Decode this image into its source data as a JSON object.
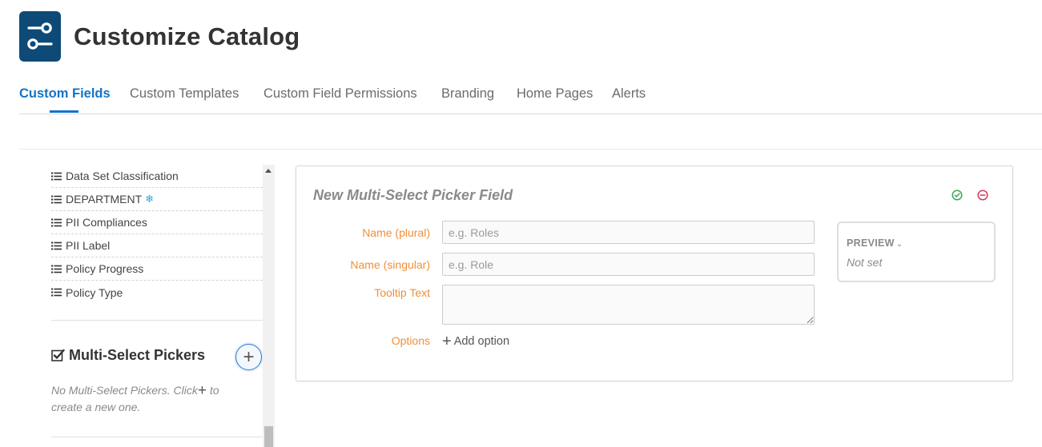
{
  "header": {
    "title": "Customize Catalog",
    "logo_icon": "settings-sliders-icon",
    "logo_color": "#0e4a77"
  },
  "tabs": [
    {
      "label": "Custom Fields",
      "active": true
    },
    {
      "label": "Custom Templates",
      "active": false
    },
    {
      "label": "Custom Field Permissions",
      "active": false
    },
    {
      "label": "Branding",
      "active": false
    },
    {
      "label": "Home Pages",
      "active": false
    },
    {
      "label": "Alerts",
      "active": false
    }
  ],
  "sidebar": {
    "items": [
      {
        "label": "Data Set Classification",
        "icon": "list-icon"
      },
      {
        "label": "DEPARTMENT",
        "icon": "list-icon",
        "badge_icon": "snowflake-icon"
      },
      {
        "label": "PII Compliances",
        "icon": "list-icon"
      },
      {
        "label": "PII Label",
        "icon": "list-icon"
      },
      {
        "label": "Policy Progress",
        "icon": "list-icon"
      },
      {
        "label": "Policy Type",
        "icon": "list-icon"
      }
    ],
    "section": {
      "title": "Multi-Select Pickers",
      "icon": "checkbox-icon",
      "add_icon": "plus-icon",
      "empty_text_before": "No Multi-Select Pickers. Click",
      "empty_text_after": "to create a new one."
    }
  },
  "form": {
    "title": "New Multi-Select Picker Field",
    "confirm_icon": "check-circle-icon",
    "cancel_icon": "minus-circle-icon",
    "name_plural_label": "Name (plural)",
    "name_plural_placeholder": "e.g. Roles",
    "name_singular_label": "Name (singular)",
    "name_singular_placeholder": "e.g. Role",
    "tooltip_label": "Tooltip Text",
    "options_label": "Options",
    "add_option_label": "Add option",
    "preview": {
      "label": "PREVIEW",
      "value": "Not set"
    }
  },
  "colors": {
    "accent": "#1473c8",
    "label_orange": "#ef8f38",
    "confirm_green": "#3aa65a",
    "cancel_red": "#d23a5a"
  }
}
